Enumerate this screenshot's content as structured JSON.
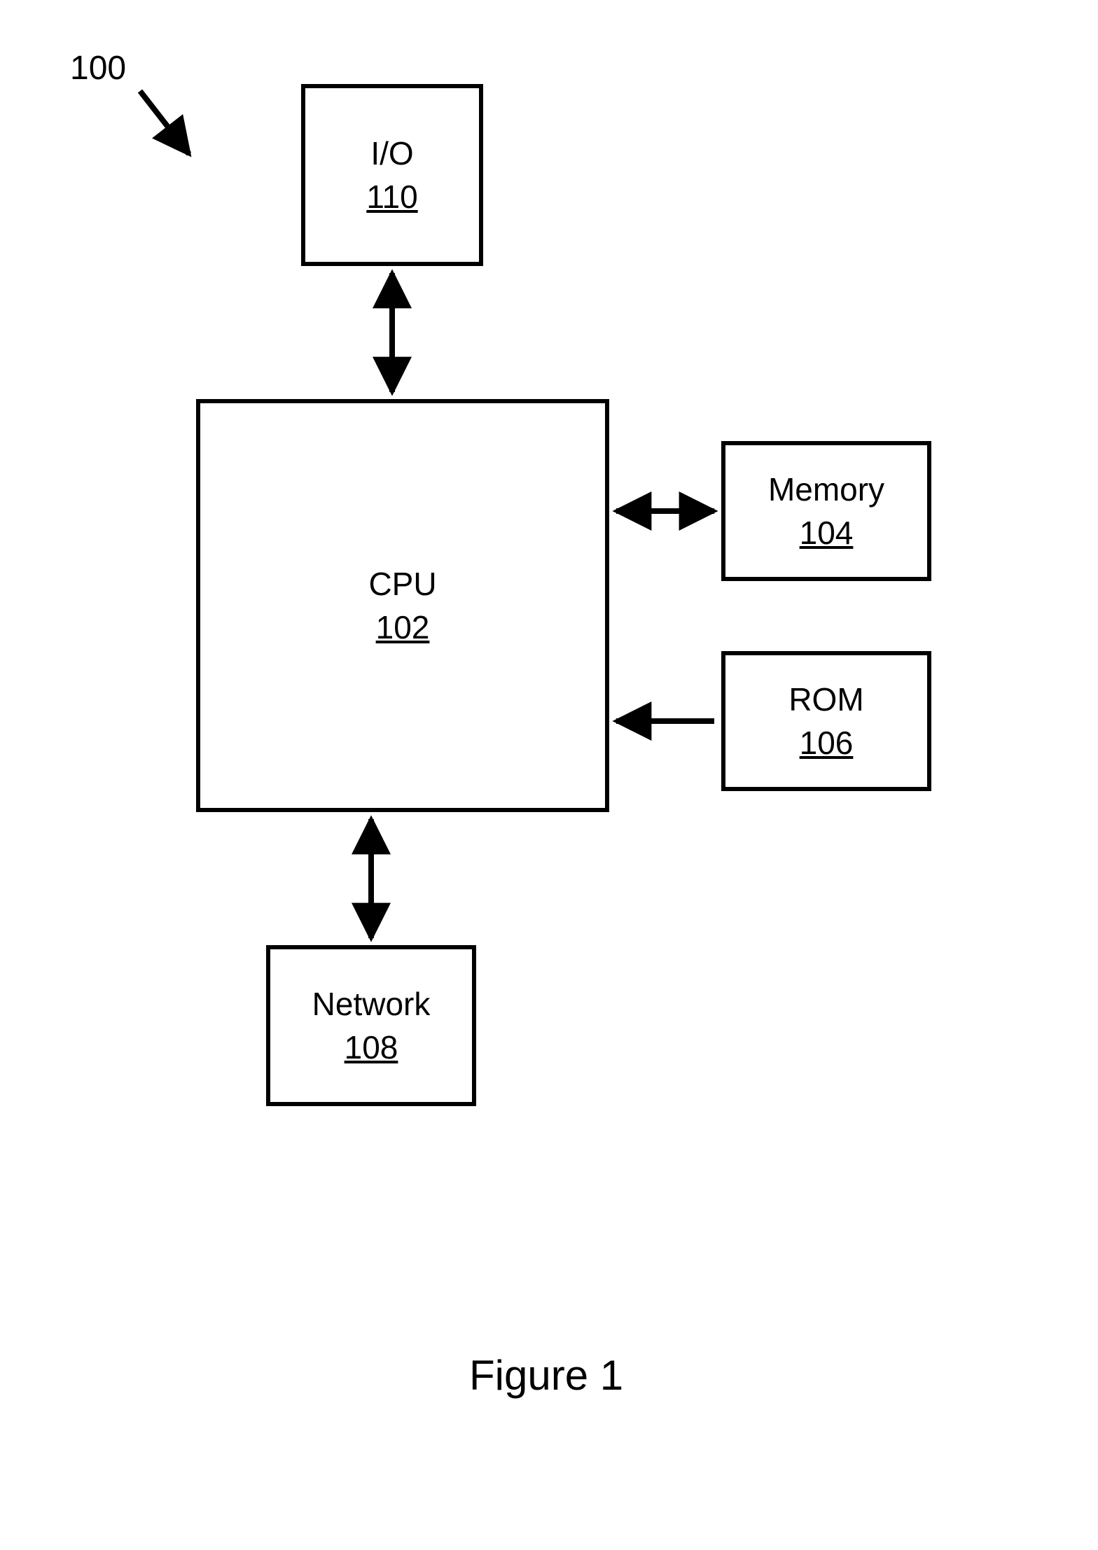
{
  "figure": {
    "caption": "Figure 1",
    "reference_number": "100"
  },
  "blocks": {
    "cpu": {
      "label": "CPU",
      "ref": "102"
    },
    "memory": {
      "label": "Memory",
      "ref": "104"
    },
    "rom": {
      "label": "ROM",
      "ref": "106"
    },
    "network": {
      "label": "Network",
      "ref": "108"
    },
    "io": {
      "label": "I/O",
      "ref": "110"
    }
  }
}
